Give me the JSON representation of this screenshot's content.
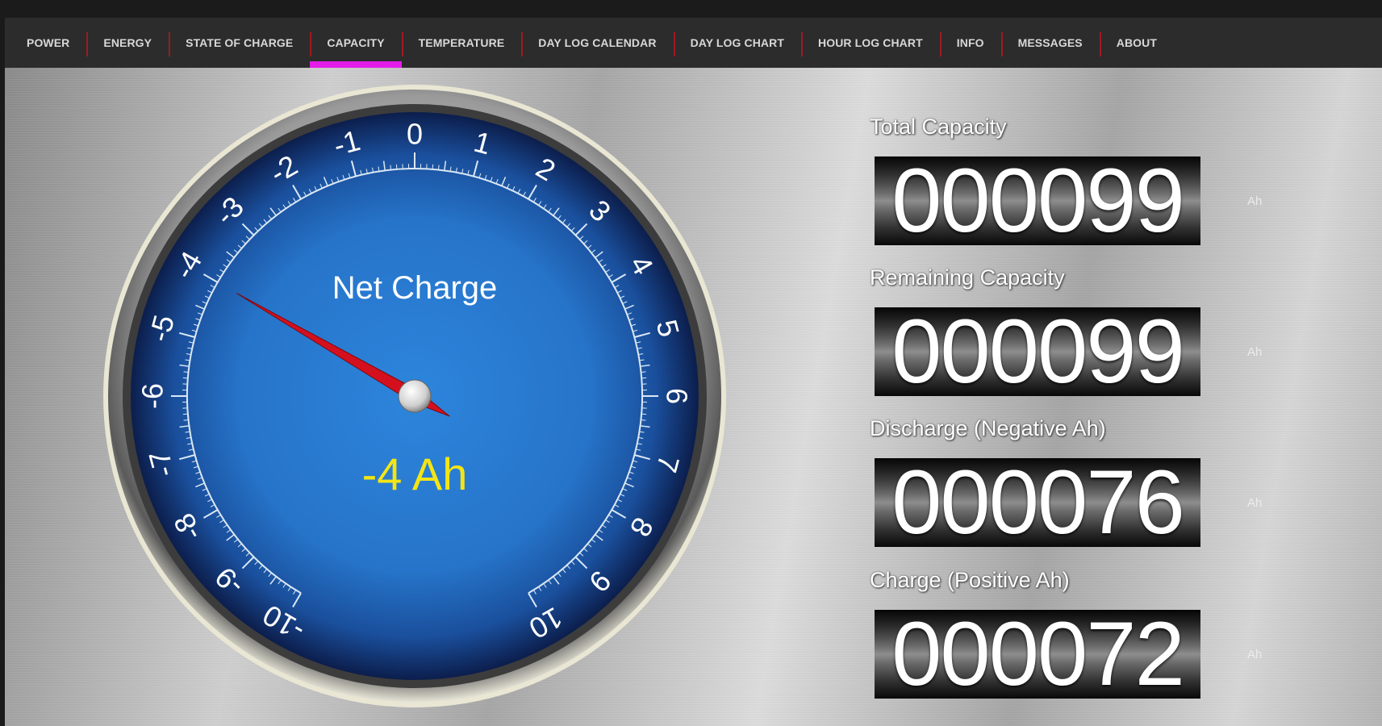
{
  "tabs": [
    {
      "label": "POWER",
      "active": false
    },
    {
      "label": "ENERGY",
      "active": false
    },
    {
      "label": "STATE OF CHARGE",
      "active": false
    },
    {
      "label": "CAPACITY",
      "active": true
    },
    {
      "label": "TEMPERATURE",
      "active": false
    },
    {
      "label": "DAY LOG CALENDAR",
      "active": false
    },
    {
      "label": "DAY LOG CHART",
      "active": false
    },
    {
      "label": "HOUR LOG CHART",
      "active": false
    },
    {
      "label": "INFO",
      "active": false
    },
    {
      "label": "MESSAGES",
      "active": false
    },
    {
      "label": "ABOUT",
      "active": false
    }
  ],
  "colors": {
    "active_tab_indicator": "#e41ce9",
    "tab_divider": "#9e1b24",
    "gauge_face": "#2a7fd4",
    "needle": "#d4101e",
    "value_text": "#f4e514"
  },
  "gauge": {
    "title": "Net Charge",
    "value": -4,
    "value_text": "-4 Ah",
    "min": -10,
    "max": 10,
    "tick_labels": [
      "-10",
      "-9",
      "-8",
      "-7",
      "-6",
      "-5",
      "-4",
      "-3",
      "-2",
      "-1",
      "0",
      "1",
      "2",
      "3",
      "4",
      "5",
      "6",
      "7",
      "8",
      "9",
      "10"
    ]
  },
  "counters": [
    {
      "label": "Total Capacity",
      "value": "000099",
      "unit": "Ah"
    },
    {
      "label": "Remaining Capacity",
      "value": "000099",
      "unit": "Ah"
    },
    {
      "label": "Discharge (Negative Ah)",
      "value": "000076",
      "unit": "Ah"
    },
    {
      "label": "Charge (Positive Ah)",
      "value": "000072",
      "unit": "Ah"
    }
  ]
}
